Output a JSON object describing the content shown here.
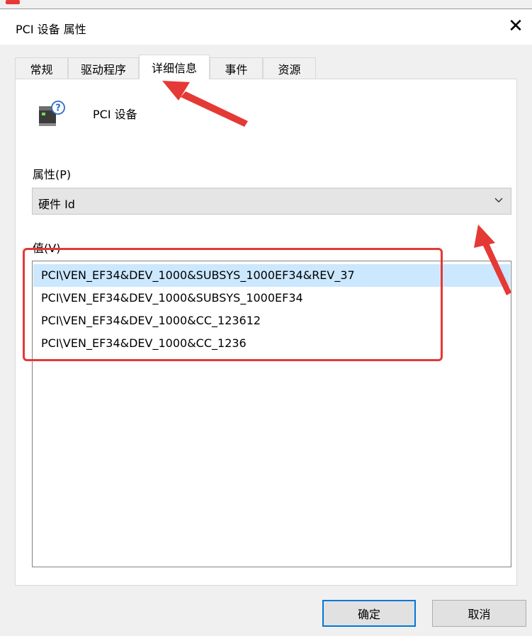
{
  "window": {
    "title": "PCI 设备 属性",
    "close_glyph": "✕"
  },
  "tabs": [
    {
      "label": "常规"
    },
    {
      "label": "驱动程序"
    },
    {
      "label": "详细信息",
      "active": true
    },
    {
      "label": "事件"
    },
    {
      "label": "资源"
    }
  ],
  "device": {
    "name": "PCI 设备",
    "icon": "unknown-pci-device-icon"
  },
  "property": {
    "label": "属性(P)",
    "selected": "硬件 Id"
  },
  "value": {
    "label": "值(V)",
    "items": [
      "PCI\\VEN_EF34&DEV_1000&SUBSYS_1000EF34&REV_37",
      "PCI\\VEN_EF34&DEV_1000&SUBSYS_1000EF34",
      "PCI\\VEN_EF34&DEV_1000&CC_123612",
      "PCI\\VEN_EF34&DEV_1000&CC_1236"
    ],
    "selected_index": 0
  },
  "buttons": {
    "ok": "确定",
    "cancel": "取消"
  },
  "colors": {
    "annotation": "#e53935",
    "selection": "#cce8ff",
    "default_button_border": "#0078d7"
  }
}
